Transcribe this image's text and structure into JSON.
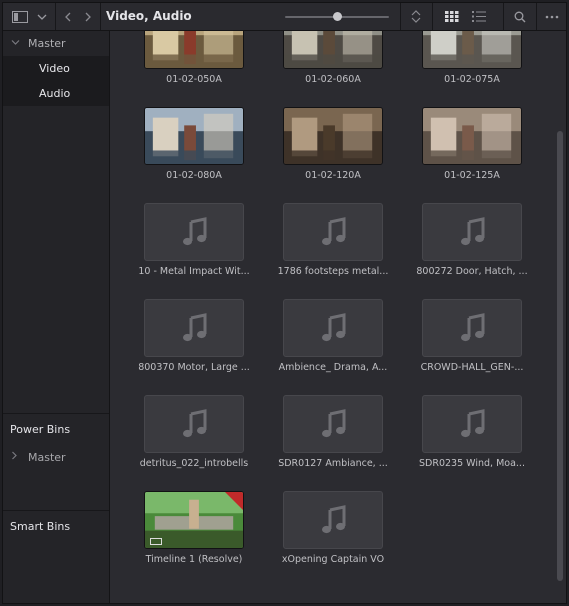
{
  "toolbar": {
    "title": "Video, Audio",
    "zoom_level": 0.5,
    "icons": [
      "panel-toggle-icon",
      "chevron-down-icon",
      "back-arrow-icon",
      "forward-arrow-icon",
      "sort-icon",
      "grid-view-icon",
      "list-view-icon",
      "search-icon",
      "more-options-icon"
    ]
  },
  "sidebar": {
    "master_label": "Master",
    "bins": [
      {
        "label": "Video"
      },
      {
        "label": "Audio"
      }
    ],
    "power_bins_header": "Power Bins",
    "power_master_label": "Master",
    "smart_bins_header": "Smart Bins"
  },
  "clips": [
    {
      "name": "01-02-050A",
      "kind": "video"
    },
    {
      "name": "01-02-060A",
      "kind": "video"
    },
    {
      "name": "01-02-075A",
      "kind": "video"
    },
    {
      "name": "01-02-080A",
      "kind": "video"
    },
    {
      "name": "01-02-120A",
      "kind": "video"
    },
    {
      "name": "01-02-125A",
      "kind": "video"
    },
    {
      "name": "10 - Metal Impact Wit...",
      "kind": "audio"
    },
    {
      "name": "1786 footsteps metal...",
      "kind": "audio"
    },
    {
      "name": "800272 Door, Hatch, ...",
      "kind": "audio"
    },
    {
      "name": "800370 Motor, Large ...",
      "kind": "audio"
    },
    {
      "name": "Ambience_ Drama, A...",
      "kind": "audio"
    },
    {
      "name": "CROWD-HALL_GEN-...",
      "kind": "audio"
    },
    {
      "name": "detritus_022_introbells",
      "kind": "audio"
    },
    {
      "name": "SDR0127 Ambiance, ...",
      "kind": "audio"
    },
    {
      "name": "SDR0235 Wind, Moa...",
      "kind": "audio"
    },
    {
      "name": "Timeline 1 (Resolve)",
      "kind": "timeline"
    },
    {
      "name": "xOpening Captain VO",
      "kind": "audio"
    }
  ],
  "colors": {
    "accent_badge": "#c02a2a",
    "background": "#2b2b30",
    "sidebar": "#242428"
  }
}
